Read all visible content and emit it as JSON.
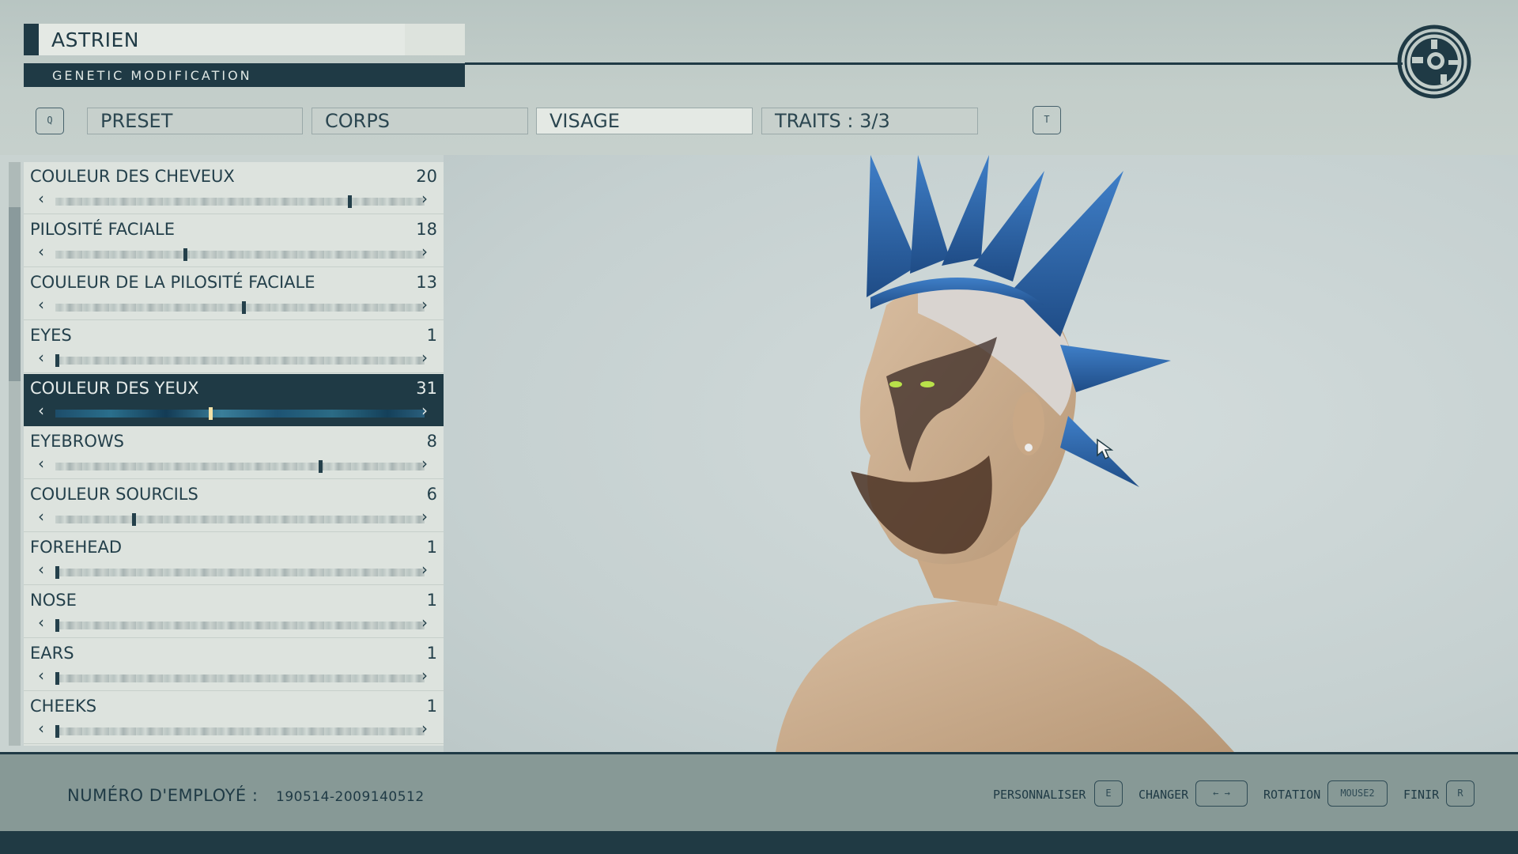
{
  "header": {
    "character_name": "ASTRIEN",
    "subtitle": "GENETIC MODIFICATION",
    "logo_icon": "gear-constellation-icon"
  },
  "tabs": {
    "left_key": "Q",
    "right_key": "T",
    "items": [
      {
        "label": "PRESET",
        "active": false
      },
      {
        "label": "CORPS",
        "active": false
      },
      {
        "label": "VISAGE",
        "active": true
      },
      {
        "label": "TRAITS : 3/3",
        "active": false
      }
    ]
  },
  "options": [
    {
      "label": "COULEUR DES CHEVEUX",
      "value": "20",
      "fraction": 0.8
    },
    {
      "label": "PILOSITÉ FACIALE",
      "value": "18",
      "fraction": 0.35
    },
    {
      "label": "COULEUR DE LA PILOSITÉ FACIALE",
      "value": "13",
      "fraction": 0.51
    },
    {
      "label": "EYES",
      "value": "1",
      "fraction": 0.0
    },
    {
      "label": "COULEUR DES YEUX",
      "value": "31",
      "fraction": 0.42,
      "selected": true
    },
    {
      "label": "EYEBROWS",
      "value": "8",
      "fraction": 0.72
    },
    {
      "label": "COULEUR SOURCILS",
      "value": "6",
      "fraction": 0.21
    },
    {
      "label": "FOREHEAD",
      "value": "1",
      "fraction": 0.0
    },
    {
      "label": "NOSE",
      "value": "1",
      "fraction": 0.0
    },
    {
      "label": "EARS",
      "value": "1",
      "fraction": 0.0
    },
    {
      "label": "CHEEKS",
      "value": "1",
      "fraction": 0.0
    }
  ],
  "arrows": {
    "left": "‹",
    "right": "›"
  },
  "footer": {
    "employee_label": "NUMÉRO D'EMPLOYÉ :",
    "employee_number": "190514-2009140512",
    "hints": [
      {
        "label": "PERSONNALISER",
        "key": "E"
      },
      {
        "label": "CHANGER",
        "key": "← →"
      },
      {
        "label": "ROTATION",
        "key": "MOUSE2"
      },
      {
        "label": "FINIR",
        "key": "R"
      }
    ]
  },
  "colors": {
    "accent_dark": "#1f3a45",
    "hair_blue": "#2f63a8",
    "eye_green": "#b9e24a"
  }
}
